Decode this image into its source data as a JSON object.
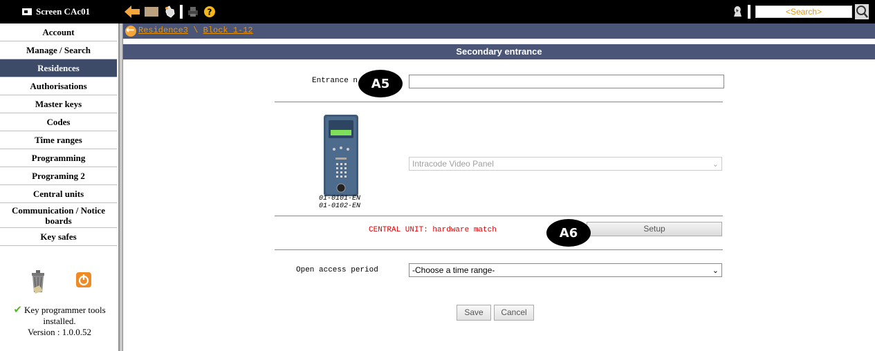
{
  "toolbar": {
    "screen_label": "Screen CAc01",
    "search_placeholder": "<Search>",
    "icons": [
      "back-arrow-icon",
      "forward-icon",
      "pointer-hand-icon",
      "print-icon",
      "help-icon",
      "user-icon",
      "search-icon"
    ]
  },
  "sidebar": {
    "items": [
      {
        "label": "Account"
      },
      {
        "label": "Manage / Search"
      },
      {
        "label": "Residences",
        "active": true
      },
      {
        "label": "Authorisations"
      },
      {
        "label": "Master keys"
      },
      {
        "label": "Codes"
      },
      {
        "label": "Time ranges"
      },
      {
        "label": "Programming"
      },
      {
        "label": "Programing 2"
      },
      {
        "label": "Central units"
      },
      {
        "label": "Communication / Notice boards"
      },
      {
        "label": "Key safes"
      }
    ],
    "status_line1": "Key programmer tools installed.",
    "status_line2": "Version : 1.0.0.52"
  },
  "breadcrumb": {
    "residence": "Residence3",
    "separator": " \\ ",
    "block": "Block 1-12"
  },
  "main": {
    "title": "Secondary entrance",
    "entrance_label": "Entrance n",
    "entrance_value": "",
    "device_refs": [
      "01-0101-EN",
      "01-0102-EN"
    ],
    "panel_selected": "Intracode Video Panel",
    "hardware_status": "CENTRAL UNIT: hardware match",
    "setup_label": "Setup",
    "open_access_label": "Open access period",
    "time_range_selected": "-Choose a time range-",
    "save_label": "Save",
    "cancel_label": "Cancel"
  },
  "badges": {
    "a5": "A5",
    "a6": "A6"
  },
  "colors": {
    "toolbar": "#000000",
    "header": "#4a5577",
    "active_nav": "#3d4a68",
    "link_orange": "#e8940a",
    "error_red": "#e00000"
  }
}
